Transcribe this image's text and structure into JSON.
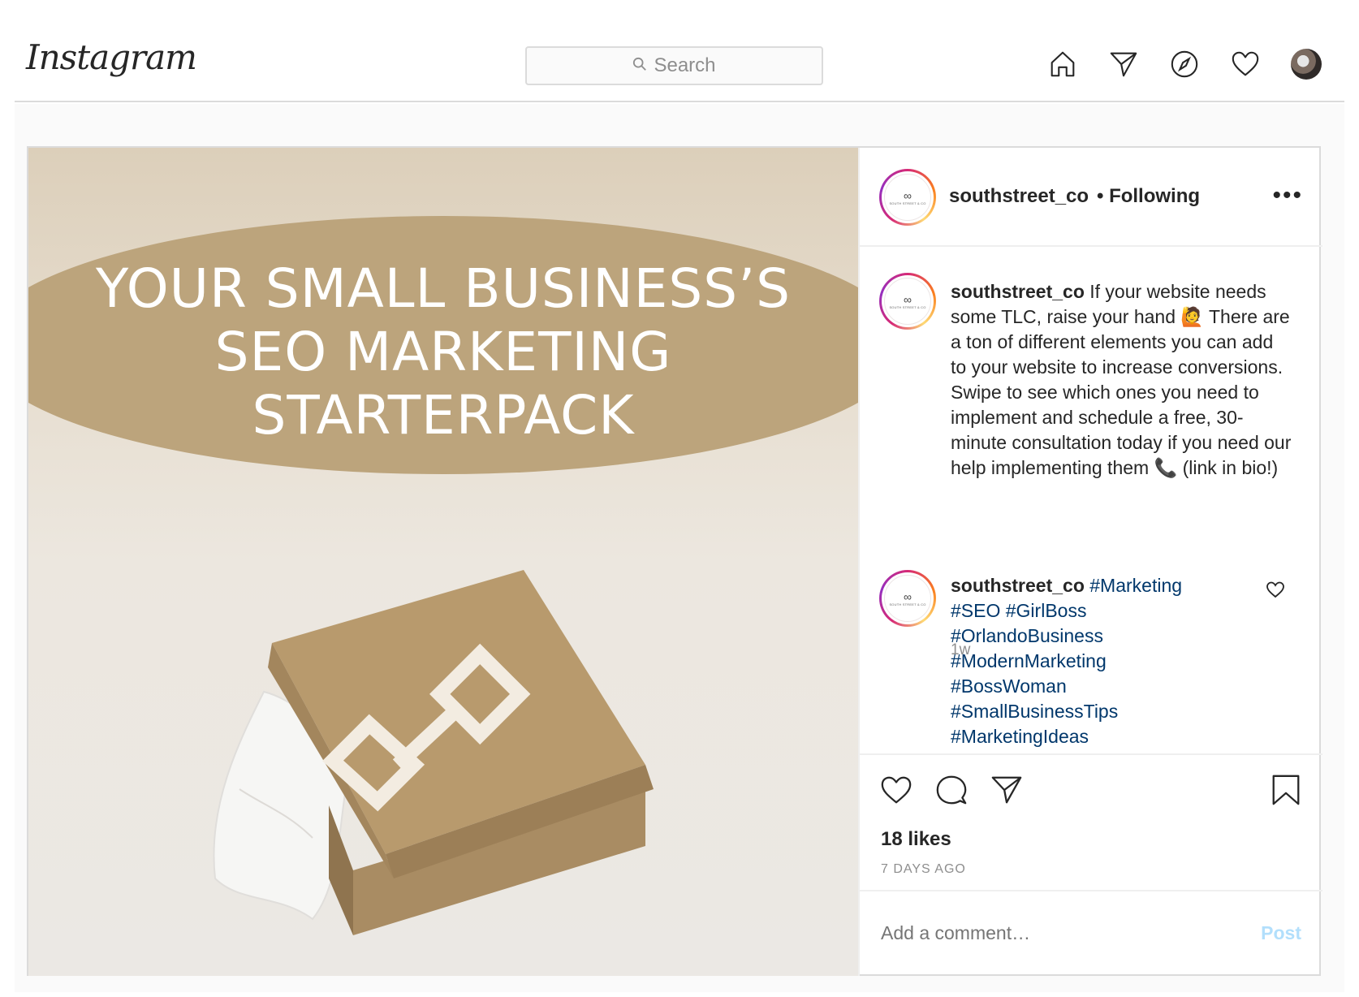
{
  "header": {
    "logo": "Instagram",
    "search_placeholder": "Search",
    "icons": [
      "home-icon",
      "direct-icon",
      "explore-icon",
      "activity-heart-icon",
      "profile-avatar"
    ]
  },
  "post": {
    "image": {
      "headline_lines": [
        "YOUR SMALL BUSINESS’S",
        "SEO MARKETING",
        "STARTERPACK"
      ]
    },
    "header": {
      "username": "southstreet_co",
      "follow_status": "• Following",
      "more": "•••",
      "avatar_text": "SOUTH STREET & CO"
    },
    "caption": {
      "username": "southstreet_co",
      "text": "If your website needs some TLC, raise your hand 🙋 There are a ton of different elements you can add to your website to increase conversions. Swipe to see which ones you need to implement and schedule a free, 30-minute consultation today if you need our help implementing them 📞 (link in bio!)",
      "age": "1w"
    },
    "comment": {
      "username": "southstreet_co",
      "tags": [
        "#Marketing",
        "#SEO #GirlBoss",
        "#OrlandoBusiness",
        "#ModernMarketing",
        "#BossWoman",
        "#SmallBusinessTips",
        "#MarketingIdeas"
      ]
    },
    "likes": "18 likes",
    "timestamp": "7 DAYS AGO",
    "add_comment_placeholder": "Add a comment…",
    "post_button": "Post"
  },
  "colors": {
    "banner": "#bca47c",
    "hashtag": "#00376b",
    "post_button_disabled": "#b2dffc"
  }
}
